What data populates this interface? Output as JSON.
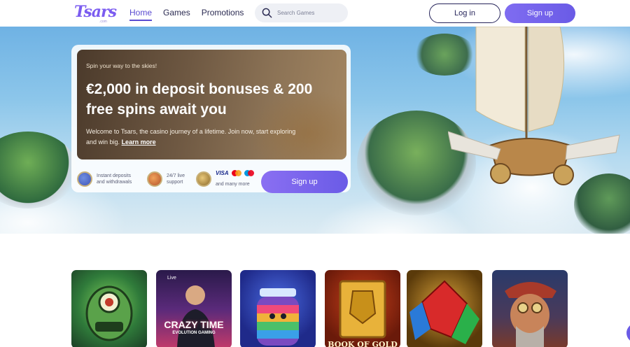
{
  "header": {
    "logo_text": "Tsars",
    "logo_sub": ".com",
    "nav": [
      {
        "label": "Home",
        "active": true
      },
      {
        "label": "Games",
        "active": false
      },
      {
        "label": "Promotions",
        "active": false
      }
    ],
    "search": {
      "placeholder": "Search Games",
      "icon": "search-icon"
    },
    "login_label": "Log in",
    "signup_label": "Sign up"
  },
  "hero": {
    "eyebrow": "Spin your way to the skies!",
    "title": "€2,000 in deposit bonuses & 200 free spins await you",
    "description": "Welcome to Tsars, the casino journey of a lifetime. Join now, start exploring and win big.",
    "link_label": "Learn more",
    "features": [
      {
        "icon": "deposit-icon",
        "text": "Instant deposits and withdrawals"
      },
      {
        "icon": "support-icon",
        "text": "24/7 live support"
      },
      {
        "icon": "payment-icon",
        "text": "and many more",
        "brand": "VISA"
      }
    ],
    "signup_label": "Sign up"
  },
  "games": [
    {
      "name": "alien-slot",
      "label": ""
    },
    {
      "name": "crazy-time",
      "label": "CRAZY TIME",
      "sublabel": "EVOLUTION GAMING",
      "badge": "Live"
    },
    {
      "name": "jar-slot",
      "label": ""
    },
    {
      "name": "book-of-gold",
      "label": "BOOK OF GOLD"
    },
    {
      "name": "gem-slot",
      "label": ""
    },
    {
      "name": "adventurer-slot",
      "label": ""
    }
  ],
  "colors": {
    "brand": "#6a5be6",
    "navy": "#26245a",
    "nav_text": "#2b2b52"
  }
}
